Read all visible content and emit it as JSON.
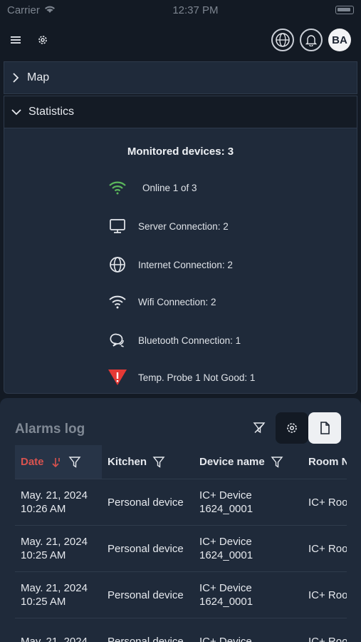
{
  "status_bar": {
    "carrier": "Carrier",
    "time": "12:37 PM"
  },
  "topbar": {
    "avatar_initials": "BA"
  },
  "accordions": [
    {
      "label": "Map",
      "expanded": false
    },
    {
      "label": "Statistics",
      "expanded": true
    }
  ],
  "statistics": {
    "title": "Monitored devices: 3",
    "rows": [
      {
        "icon": "wifi-online-icon",
        "text": "Online 1 of 3"
      },
      {
        "icon": "monitor-icon",
        "text": "Server Connection: 2"
      },
      {
        "icon": "globe-icon",
        "text": "Internet Connection: 2"
      },
      {
        "icon": "wifi-icon",
        "text": "Wifi Connection: 2"
      },
      {
        "icon": "bluetooth-chat-icon",
        "text": "Bluetooth Connection: 1"
      },
      {
        "icon": "warning-icon",
        "text": "Temp. Probe 1 Not Good: 1"
      }
    ]
  },
  "alarms": {
    "title": "Alarms log",
    "columns": {
      "date": "Date",
      "kitchen": "Kitchen",
      "device": "Device name",
      "room": "Room N"
    },
    "rows": [
      {
        "date": "May. 21, 2024\n10:26 AM",
        "kitchen": "Personal device",
        "device": "IC+ Device\n1624_0001",
        "room": "IC+ Roo"
      },
      {
        "date": "May. 21, 2024\n10:25 AM",
        "kitchen": "Personal device",
        "device": "IC+ Device\n1624_0001",
        "room": "IC+ Roo"
      },
      {
        "date": "May. 21, 2024\n10:25 AM",
        "kitchen": "Personal device",
        "device": "IC+ Device\n1624_0001",
        "room": "IC+ Roo"
      },
      {
        "date": "May. 21, 2024",
        "kitchen": "Personal device",
        "device": "IC+ Device",
        "room": "IC+ Roo"
      }
    ]
  },
  "colors": {
    "accent_red": "#d9534f",
    "wifi_green": "#5cb85c",
    "panel": "#1f2a3a",
    "background": "#131a24"
  }
}
